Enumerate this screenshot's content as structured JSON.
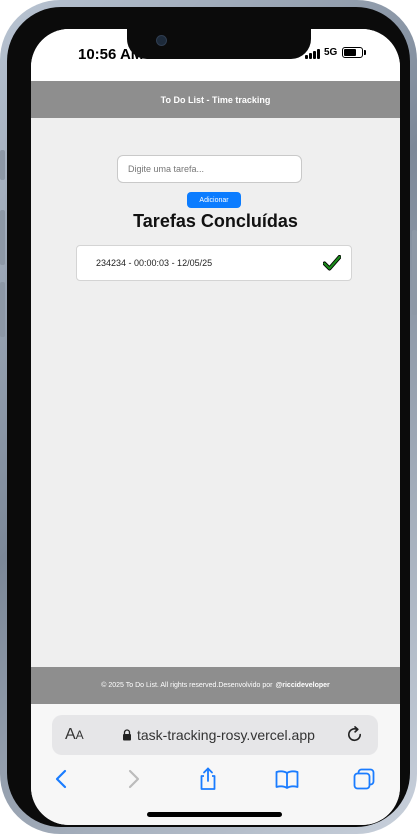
{
  "status_bar": {
    "time": "10:56 AM",
    "network": "5G",
    "battery_level": 0.85
  },
  "header": {
    "title": "To Do List - Time tracking"
  },
  "form": {
    "task_placeholder": "Digite uma tarefa...",
    "task_value": "",
    "add_label": "Adicionar"
  },
  "completed": {
    "title": "Tarefas Concluídas",
    "tasks": [
      {
        "text": "234234 - 00:00:03 - 12/05/25",
        "status_icon": "check-icon"
      }
    ]
  },
  "footer": {
    "text": "© 2025 To Do List. All rights reserved.Desenvolvido por",
    "handle": "@riccideveloper"
  },
  "browser": {
    "text_size_label": "AA",
    "url": "task-tracking-rosy.vercel.app",
    "icons": [
      "lock-icon",
      "reload-icon",
      "back-icon",
      "forward-icon",
      "share-icon",
      "bookmarks-icon",
      "tabs-icon"
    ]
  },
  "colors": {
    "accent": "#0b7cff",
    "header_bg": "#8e8e8e",
    "page_bg": "#efefef",
    "check": "#1a8a1a"
  }
}
